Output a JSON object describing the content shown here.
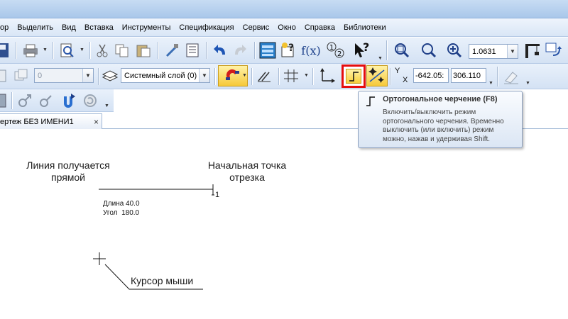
{
  "menu": [
    {
      "label": "ор"
    },
    {
      "label": "Выделить"
    },
    {
      "label": "Вид"
    },
    {
      "label": "Вставка"
    },
    {
      "label": "Инструменты"
    },
    {
      "label": "Спецификация"
    },
    {
      "label": "Сервис"
    },
    {
      "label": "Окно"
    },
    {
      "label": "Справка"
    },
    {
      "label": "Библиотеки"
    }
  ],
  "toolbar": {
    "zoom_value": "1.0631",
    "fx_label": "f(x)",
    "style_combo_value": "0",
    "layer_combo_value": "Системный слой (0)",
    "coord_x_label": "Y",
    "coord_y_label": "X",
    "coord_x_value": "-642.05:",
    "coord_y_value": "306.110"
  },
  "document_tab": {
    "label": "ертеж БЕЗ ИМЕНИ1",
    "close": "×"
  },
  "tooltip": {
    "title": "Ортогональное черчение (F8)",
    "body": "Включить/выключить режим ортогонального черчения. Временно выключить (или включить) режим можно, нажав и удерживая Shift."
  },
  "canvas": {
    "annotation_line": "Линия получается прямой",
    "annotation_start": "Начальная точка отрезка",
    "annotation_cursor": "Курсор мыши",
    "point_label": "1",
    "length_text": "Длина 40.0",
    "angle_text": "Угол  180.0"
  },
  "colors": {
    "highlight_border": "#e60d0d",
    "ortho_button_fill": "#f7cf3c",
    "magnet_red": "#d21c1c"
  },
  "icons": [
    "save-icon",
    "print-icon",
    "preview-icon",
    "cut-icon",
    "copy-icon",
    "paste-icon",
    "brush-icon",
    "properties-icon",
    "undo-icon",
    "redo-icon",
    "tree-icon",
    "variables-icon",
    "fx-icon",
    "numbering-icon",
    "help-cursor-icon",
    "zoom-window-icon",
    "zoom-scale-icon",
    "zoom-in-icon",
    "crane-icon",
    "refresh-icon",
    "layer-icon",
    "snap-magnet-icon",
    "parallel-icon",
    "grid-icon",
    "local-cs-icon",
    "ortho-icon",
    "snap-points-icon",
    "eraser-icon"
  ]
}
